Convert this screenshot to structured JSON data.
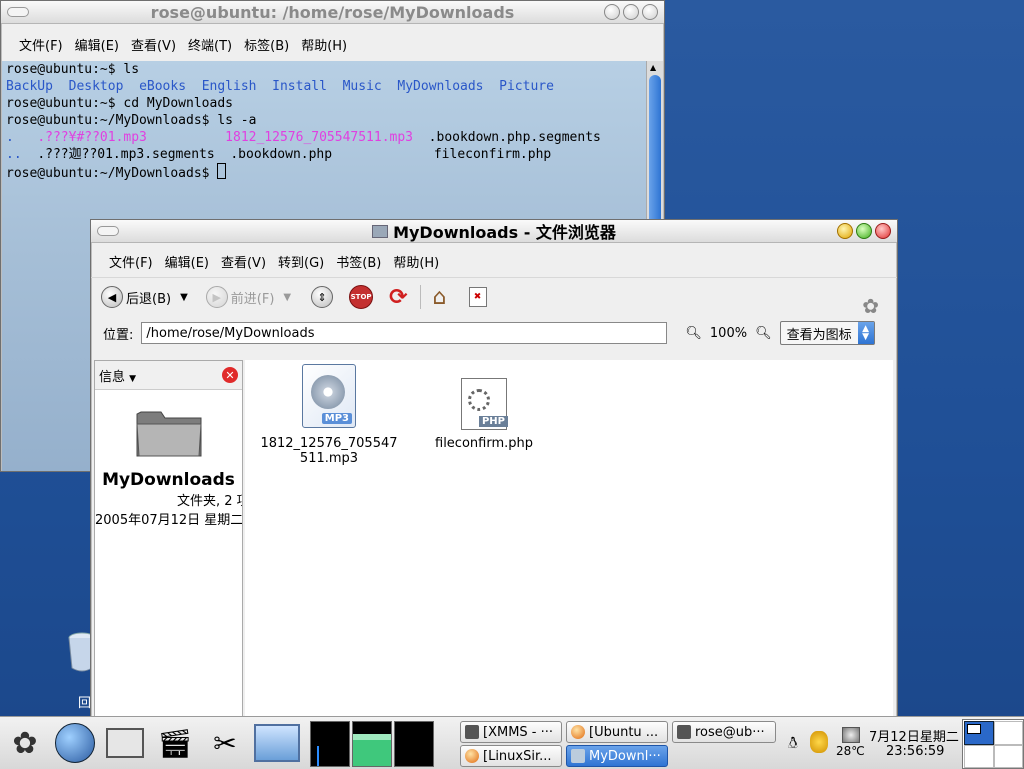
{
  "terminal": {
    "title": "rose@ubuntu: /home/rose/MyDownloads",
    "menu": [
      "文件(F)",
      "编辑(E)",
      "查看(V)",
      "终端(T)",
      "标签(B)",
      "帮助(H)"
    ],
    "lines": {
      "l1": "rose@ubuntu:~$ ls",
      "l2": [
        "BackUp",
        "Desktop",
        "eBooks",
        "English",
        "Install",
        "Music",
        "MyDownloads",
        "Picture"
      ],
      "l3": "rose@ubuntu:~$ cd MyDownloads",
      "l4": "rose@ubuntu:~/MyDownloads$ ls -a",
      "l5a": ".",
      "l5b": ".???¥#??01.mp3",
      "l5c": "1812_12576_705547511.mp3",
      "l5d": ".bookdown.php.segments",
      "l6a": "..",
      "l6b": ".???迦??01.mp3.segments",
      "l6c": ".bookdown.php",
      "l6d": "fileconfirm.php",
      "l7": "rose@ubuntu:~/MyDownloads$ "
    }
  },
  "browser": {
    "title": "MyDownloads - 文件浏览器",
    "menu": [
      "文件(F)",
      "编辑(E)",
      "查看(V)",
      "转到(G)",
      "书签(B)",
      "帮助(H)"
    ],
    "toolbar": {
      "back": "后退(B)",
      "forward": "前进(F)"
    },
    "location_label": "位置:",
    "location_value": "/home/rose/MyDownloads",
    "zoom": "100%",
    "view_as": "查看为图标",
    "sidepane": {
      "header": "信息",
      "folder_name": "MyDownloads",
      "folder_info": "文件夹, 2 项",
      "folder_date": "2005年07月12日 星期二"
    },
    "files": [
      {
        "name_line1": "1812_12576_705547",
        "name_line2": "511.mp3",
        "badge": "MP3"
      },
      {
        "name_line1": "fileconfirm.php",
        "name_line2": "",
        "badge": "PHP"
      }
    ]
  },
  "desktop_icon_label": "回",
  "taskbar": {
    "tasks": [
      "[XMMS - ···",
      "[Ubuntu ...",
      "rose@ub···",
      "[LinuxSir...",
      "MyDownl···"
    ],
    "temp": "28℃",
    "date": "7月12日星期二",
    "time": "23:56:59"
  }
}
